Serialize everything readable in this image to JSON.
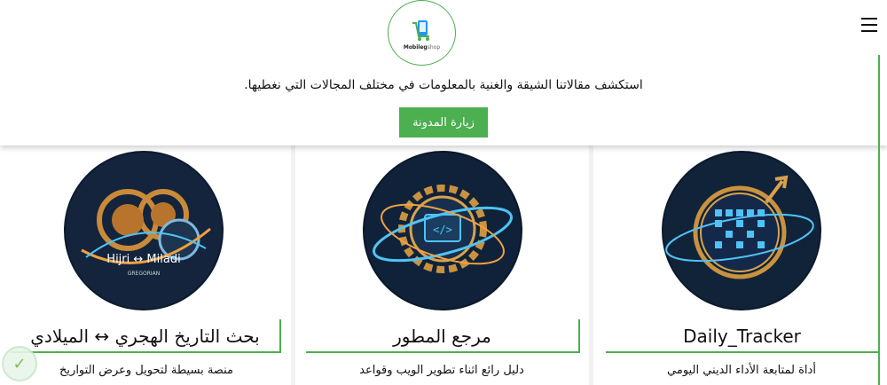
{
  "header": {
    "logo_text": "Mobileg",
    "logo_suffix": "shop",
    "tagline": "استكشف مقالاتنا الشيقة والغنية بالمعلومات في مختلف المجالات التي نغطيها.",
    "visit_button": "زيارة المدونة",
    "menu_icon": "hamburger-icon"
  },
  "cards": [
    {
      "title": "بحث التاريخ الهجري ↔ الميلادي",
      "image_text": "Hijri ↔ Miladi",
      "image_subtext": "GREGORIAN",
      "description": "منصة بسيطة لتحويل وعرض التواريخ",
      "icon": "gears-clock-icon"
    },
    {
      "title": "مرجع المطور",
      "description": "دليل رائع اثناء تطوير الويب وقواعد",
      "icon": "code-gear-icon"
    },
    {
      "title": "Daily_Tracker",
      "description": "أداة لمتابعة الأداء الديني اليومي",
      "icon": "calendar-tracker-icon"
    }
  ],
  "colors": {
    "accent": "#4caf50",
    "card_bg": "#ffffff",
    "page_bg": "#f2f2f2"
  }
}
